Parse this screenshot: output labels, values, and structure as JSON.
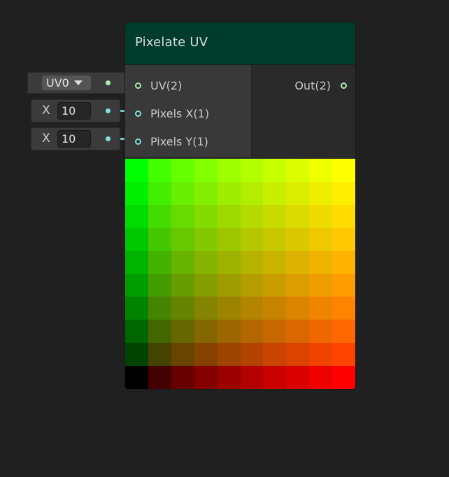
{
  "node": {
    "title": "Pixelate UV",
    "header_color": "#003c2c",
    "inputs": [
      {
        "label": "UV(2)",
        "type": "uv-port",
        "color": "#a8f0b0"
      },
      {
        "label": "Pixels X(1)",
        "type": "float-port",
        "color": "#84e0df"
      },
      {
        "label": "Pixels Y(1)",
        "type": "float-port",
        "color": "#84e0df"
      }
    ],
    "outputs": [
      {
        "label": "Out(2)",
        "type": "uv-port",
        "color": "#a8f0b0"
      }
    ],
    "preview": {
      "grid": 10,
      "description_colors": {
        "bottom_left": "#000000",
        "bottom_right": "#ff0000",
        "top_left": "#00ff00",
        "top_right": "#ffff00"
      }
    }
  },
  "external_inputs": {
    "uv_dropdown": {
      "value": "UV0",
      "icon": "dropdown-arrow-icon"
    },
    "pixels_x": {
      "axis_label": "X",
      "value": "10"
    },
    "pixels_y": {
      "axis_label": "X",
      "value": "10"
    }
  }
}
